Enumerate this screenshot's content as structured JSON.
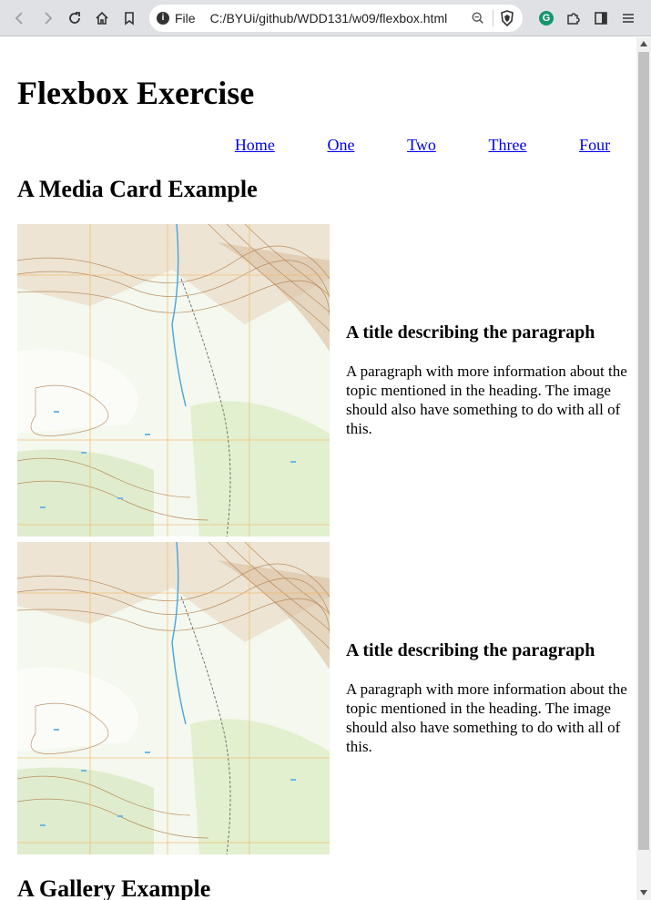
{
  "browser": {
    "scheme": "File",
    "url": "C:/BYUi/github/WDD131/w09/flexbox.html",
    "extension_letter": "G"
  },
  "page": {
    "title": "Flexbox Exercise",
    "nav": [
      "Home",
      "One",
      "Two",
      "Three",
      "Four"
    ],
    "media_heading": "A Media Card Example",
    "cards": [
      {
        "title": "A title describing the paragraph",
        "text": "A paragraph with more information about the topic mentioned in the heading. The image should also have something to do with all of this.",
        "image": "topographic-map"
      },
      {
        "title": "A title describing the paragraph",
        "text": "A paragraph with more information about the topic mentioned in the heading. The image should also have something to do with all of this.",
        "image": "topographic-map"
      }
    ],
    "gallery_heading": "A Gallery Example"
  }
}
